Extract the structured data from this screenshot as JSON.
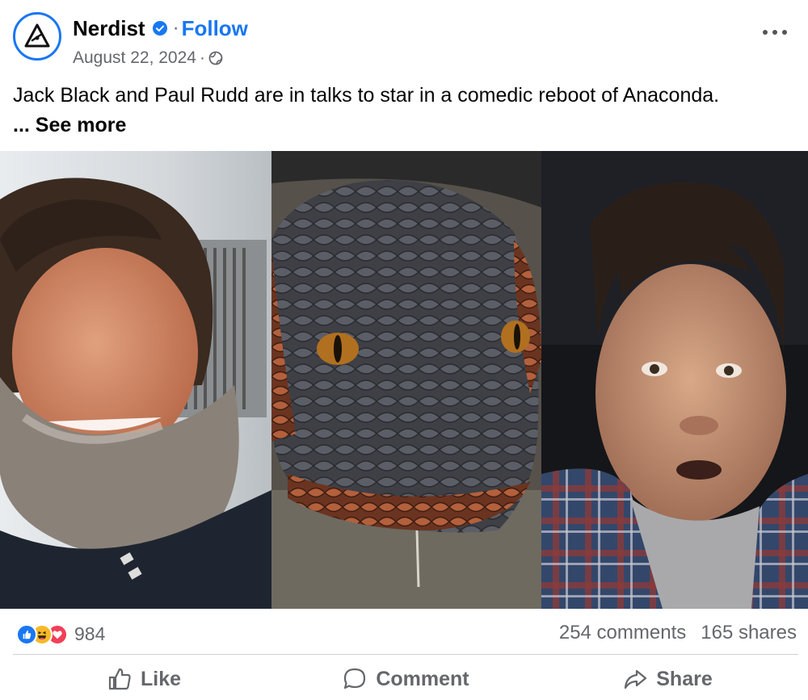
{
  "post": {
    "page_name": "Nerdist",
    "separator": "·",
    "follow_label": "Follow",
    "date": "August 22, 2024",
    "date_separator": "·",
    "audience_icon": "globe-icon",
    "text": "Jack Black and Paul Rudd are in talks to star in a comedic reboot of Anaconda.",
    "see_more": "... See more"
  },
  "media": {
    "panels": [
      "Jack Black",
      "Anaconda snake",
      "Paul Rudd"
    ]
  },
  "stats": {
    "reaction_icons": [
      "like-icon",
      "haha-icon",
      "love-icon"
    ],
    "reactions_count": "984",
    "comments": "254 comments",
    "shares": "165 shares"
  },
  "actions": {
    "like": "Like",
    "comment": "Comment",
    "share": "Share"
  },
  "colors": {
    "brand_blue": "#1877f2",
    "secondary_text": "#65676b",
    "haha": "#f7b928",
    "love": "#f33e58"
  }
}
